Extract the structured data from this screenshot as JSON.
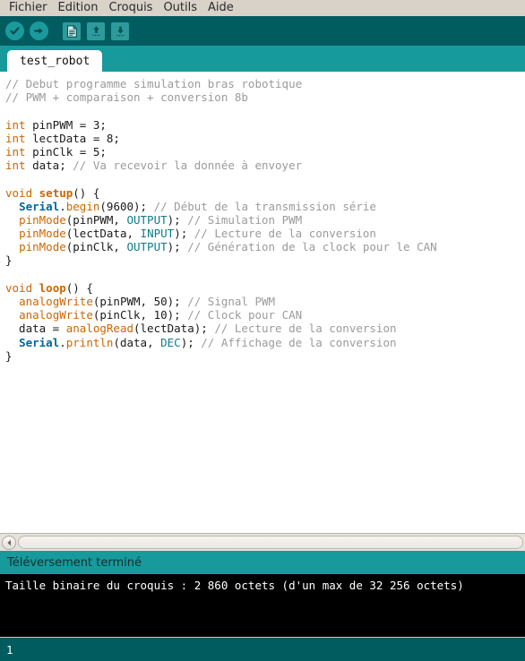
{
  "window": {
    "title": "test_robot | Arduino IDE",
    "colors": {
      "menubar_bg": "#d9d2c9",
      "toolbar_bg": "#005c5f",
      "tabbar_bg": "#179a9c",
      "accent_teal": "#1b9a9c",
      "editor_bg": "#ffffff",
      "console_bg": "#000000",
      "bottombar_bg": "#005c5f",
      "comment": "#9b9b9b",
      "keyword": "#cc6600",
      "literal": "#0e7c8c",
      "object": "#006699"
    }
  },
  "menubar": {
    "items": [
      {
        "label": "Fichier",
        "name": "menu-fichier"
      },
      {
        "label": "Edition",
        "name": "menu-edition"
      },
      {
        "label": "Croquis",
        "name": "menu-croquis"
      },
      {
        "label": "Outils",
        "name": "menu-outils"
      },
      {
        "label": "Aide",
        "name": "menu-aide"
      }
    ]
  },
  "toolbar": {
    "buttons": [
      {
        "icon": "verify-check-icon",
        "tooltip": "Vérifier",
        "shape": "circle"
      },
      {
        "icon": "upload-arrow-icon",
        "tooltip": "Téléverser",
        "shape": "circle"
      },
      {
        "icon": "new-document-icon",
        "tooltip": "Nouveau",
        "shape": "square"
      },
      {
        "icon": "open-folder-up-arrow-icon",
        "tooltip": "Ouvrir",
        "shape": "square"
      },
      {
        "icon": "save-down-arrow-icon",
        "tooltip": "Enregistrer",
        "shape": "square"
      }
    ]
  },
  "tabs": [
    {
      "label": "test_robot",
      "active": true
    }
  ],
  "editor": {
    "lines": [
      [
        {
          "t": "// Debut programme simulation bras robotique",
          "c": "t-comment"
        }
      ],
      [
        {
          "t": "// PWM + comparaison + conversion 8b",
          "c": "t-comment"
        }
      ],
      [],
      [
        {
          "t": "int",
          "c": "t-keyword"
        },
        {
          "t": " pinPWM = 3;",
          "c": "t-plain"
        }
      ],
      [
        {
          "t": "int",
          "c": "t-keyword"
        },
        {
          "t": " lectData = 8;",
          "c": "t-plain"
        }
      ],
      [
        {
          "t": "int",
          "c": "t-keyword"
        },
        {
          "t": " pinClk = 5;",
          "c": "t-plain"
        }
      ],
      [
        {
          "t": "int",
          "c": "t-keyword"
        },
        {
          "t": " data; ",
          "c": "t-plain"
        },
        {
          "t": "// Va recevoir la donnée à envoyer",
          "c": "t-comment"
        }
      ],
      [],
      [
        {
          "t": "void ",
          "c": "t-keyword"
        },
        {
          "t": "setup",
          "c": "t-func"
        },
        {
          "t": "() {",
          "c": "t-plain"
        }
      ],
      [
        {
          "t": "  ",
          "c": "t-plain"
        },
        {
          "t": "Serial",
          "c": "t-obj"
        },
        {
          "t": ".",
          "c": "t-plain"
        },
        {
          "t": "begin",
          "c": "t-call"
        },
        {
          "t": "(9600); ",
          "c": "t-plain"
        },
        {
          "t": "// Début de la transmission série",
          "c": "t-comment"
        }
      ],
      [
        {
          "t": "  ",
          "c": "t-plain"
        },
        {
          "t": "pinMode",
          "c": "t-call"
        },
        {
          "t": "(pinPWM, ",
          "c": "t-plain"
        },
        {
          "t": "OUTPUT",
          "c": "t-lit"
        },
        {
          "t": "); ",
          "c": "t-plain"
        },
        {
          "t": "// Simulation PWM",
          "c": "t-comment"
        }
      ],
      [
        {
          "t": "  ",
          "c": "t-plain"
        },
        {
          "t": "pinMode",
          "c": "t-call"
        },
        {
          "t": "(lectData, ",
          "c": "t-plain"
        },
        {
          "t": "INPUT",
          "c": "t-lit"
        },
        {
          "t": "); ",
          "c": "t-plain"
        },
        {
          "t": "// Lecture de la conversion",
          "c": "t-comment"
        }
      ],
      [
        {
          "t": "  ",
          "c": "t-plain"
        },
        {
          "t": "pinMode",
          "c": "t-call"
        },
        {
          "t": "(pinClk, ",
          "c": "t-plain"
        },
        {
          "t": "OUTPUT",
          "c": "t-lit"
        },
        {
          "t": "); ",
          "c": "t-plain"
        },
        {
          "t": "// Génération de la clock pour le CAN",
          "c": "t-comment"
        }
      ],
      [
        {
          "t": "}",
          "c": "t-plain"
        }
      ],
      [],
      [
        {
          "t": "void ",
          "c": "t-keyword"
        },
        {
          "t": "loop",
          "c": "t-func"
        },
        {
          "t": "() {",
          "c": "t-plain"
        }
      ],
      [
        {
          "t": "  ",
          "c": "t-plain"
        },
        {
          "t": "analogWrite",
          "c": "t-call"
        },
        {
          "t": "(pinPWM, 50); ",
          "c": "t-plain"
        },
        {
          "t": "// Signal PWM",
          "c": "t-comment"
        }
      ],
      [
        {
          "t": "  ",
          "c": "t-plain"
        },
        {
          "t": "analogWrite",
          "c": "t-call"
        },
        {
          "t": "(pinClk, 10); ",
          "c": "t-plain"
        },
        {
          "t": "// Clock pour CAN",
          "c": "t-comment"
        }
      ],
      [
        {
          "t": "  data = ",
          "c": "t-plain"
        },
        {
          "t": "analogRead",
          "c": "t-call"
        },
        {
          "t": "(lectData); ",
          "c": "t-plain"
        },
        {
          "t": "// Lecture de la conversion",
          "c": "t-comment"
        }
      ],
      [
        {
          "t": "  ",
          "c": "t-plain"
        },
        {
          "t": "Serial",
          "c": "t-obj"
        },
        {
          "t": ".",
          "c": "t-plain"
        },
        {
          "t": "println",
          "c": "t-call"
        },
        {
          "t": "(data, ",
          "c": "t-plain"
        },
        {
          "t": "DEC",
          "c": "t-lit"
        },
        {
          "t": "); ",
          "c": "t-plain"
        },
        {
          "t": "// Affichage de la conversion",
          "c": "t-comment"
        }
      ],
      [
        {
          "t": "}",
          "c": "t-plain"
        }
      ]
    ]
  },
  "status": {
    "message": "Téléversement terminé"
  },
  "console": {
    "lines": [
      "Taille binaire du croquis : 2 860 octets (d'un max de 32 256 octets)"
    ]
  },
  "bottombar": {
    "line_number": "1"
  }
}
